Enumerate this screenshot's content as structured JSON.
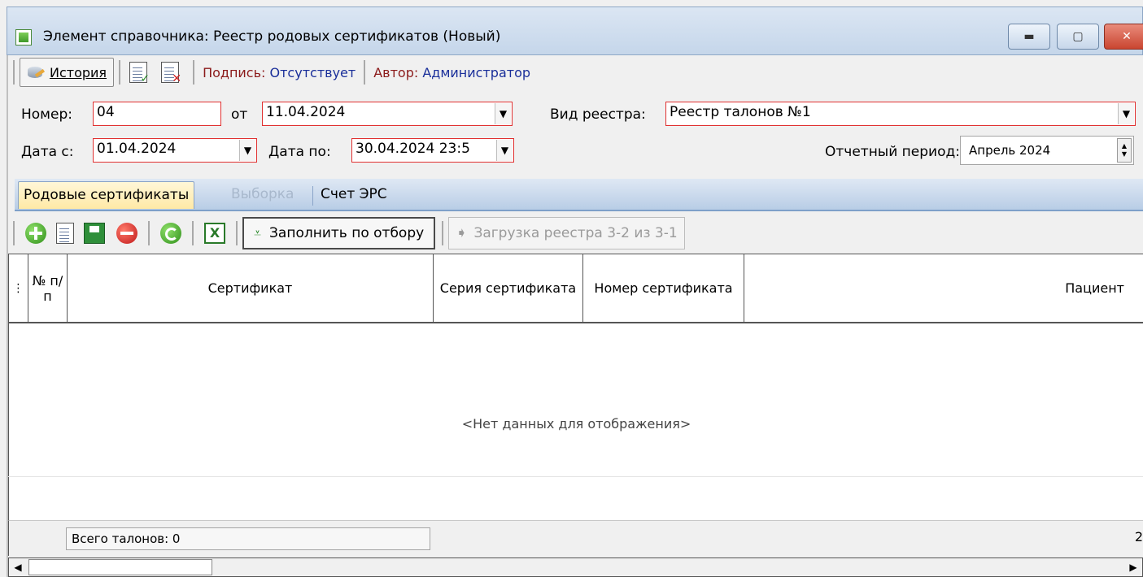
{
  "window": {
    "title": "Элемент справочника: Реестр родовых сертификатов (Новый)",
    "minimize_glyph": "▬",
    "maximize_glyph": "▢",
    "close_glyph": "✕"
  },
  "header_toolbar": {
    "history_label": "История",
    "signature_label": "Подпись:",
    "signature_value": "Отсутствует",
    "author_label": "Автор:",
    "author_value": "Администратор",
    "doc_check_glyph": "✓",
    "doc_cross_glyph": "✕"
  },
  "form": {
    "number_label": "Номер:",
    "number_value": "04",
    "from_label": "от",
    "from_value": "11.04.2024",
    "registry_type_label": "Вид реестра:",
    "registry_type_value": "Реестр талонов №1",
    "date_from_label": "Дата с:",
    "date_from_value": "01.04.2024",
    "date_to_label": "Дата по:",
    "date_to_value": "30.04.2024 23:5",
    "period_label": "Отчетный период:",
    "period_value": "Апрель  2024",
    "dropdown_glyph": "▼",
    "spin_up_glyph": "▲",
    "spin_down_glyph": "▼"
  },
  "tabs": [
    {
      "label": "Родовые сертификаты",
      "active": true
    },
    {
      "label": "Выборка",
      "disabled": true
    },
    {
      "label": "Счет ЭРС"
    }
  ],
  "grid_toolbar": {
    "fill_label": "Заполнить по отбору",
    "fill_glyph": "⩡",
    "load_label": "Загрузка реестра 3-2 из 3-1",
    "load_glyph": "➧",
    "excel_glyph": "X"
  },
  "grid": {
    "columns": [
      "№ п/п",
      "Сертификат",
      "Серия сертификата",
      "Номер сертификата",
      "Пациент"
    ],
    "column_menu_glyph": "⋮",
    "empty_message": "<Нет данных для отображения>"
  },
  "footer": {
    "total_label": "Всего талонов: 0",
    "page_number": "2",
    "scroll_left_glyph": "◀",
    "scroll_right_glyph": "▶"
  }
}
